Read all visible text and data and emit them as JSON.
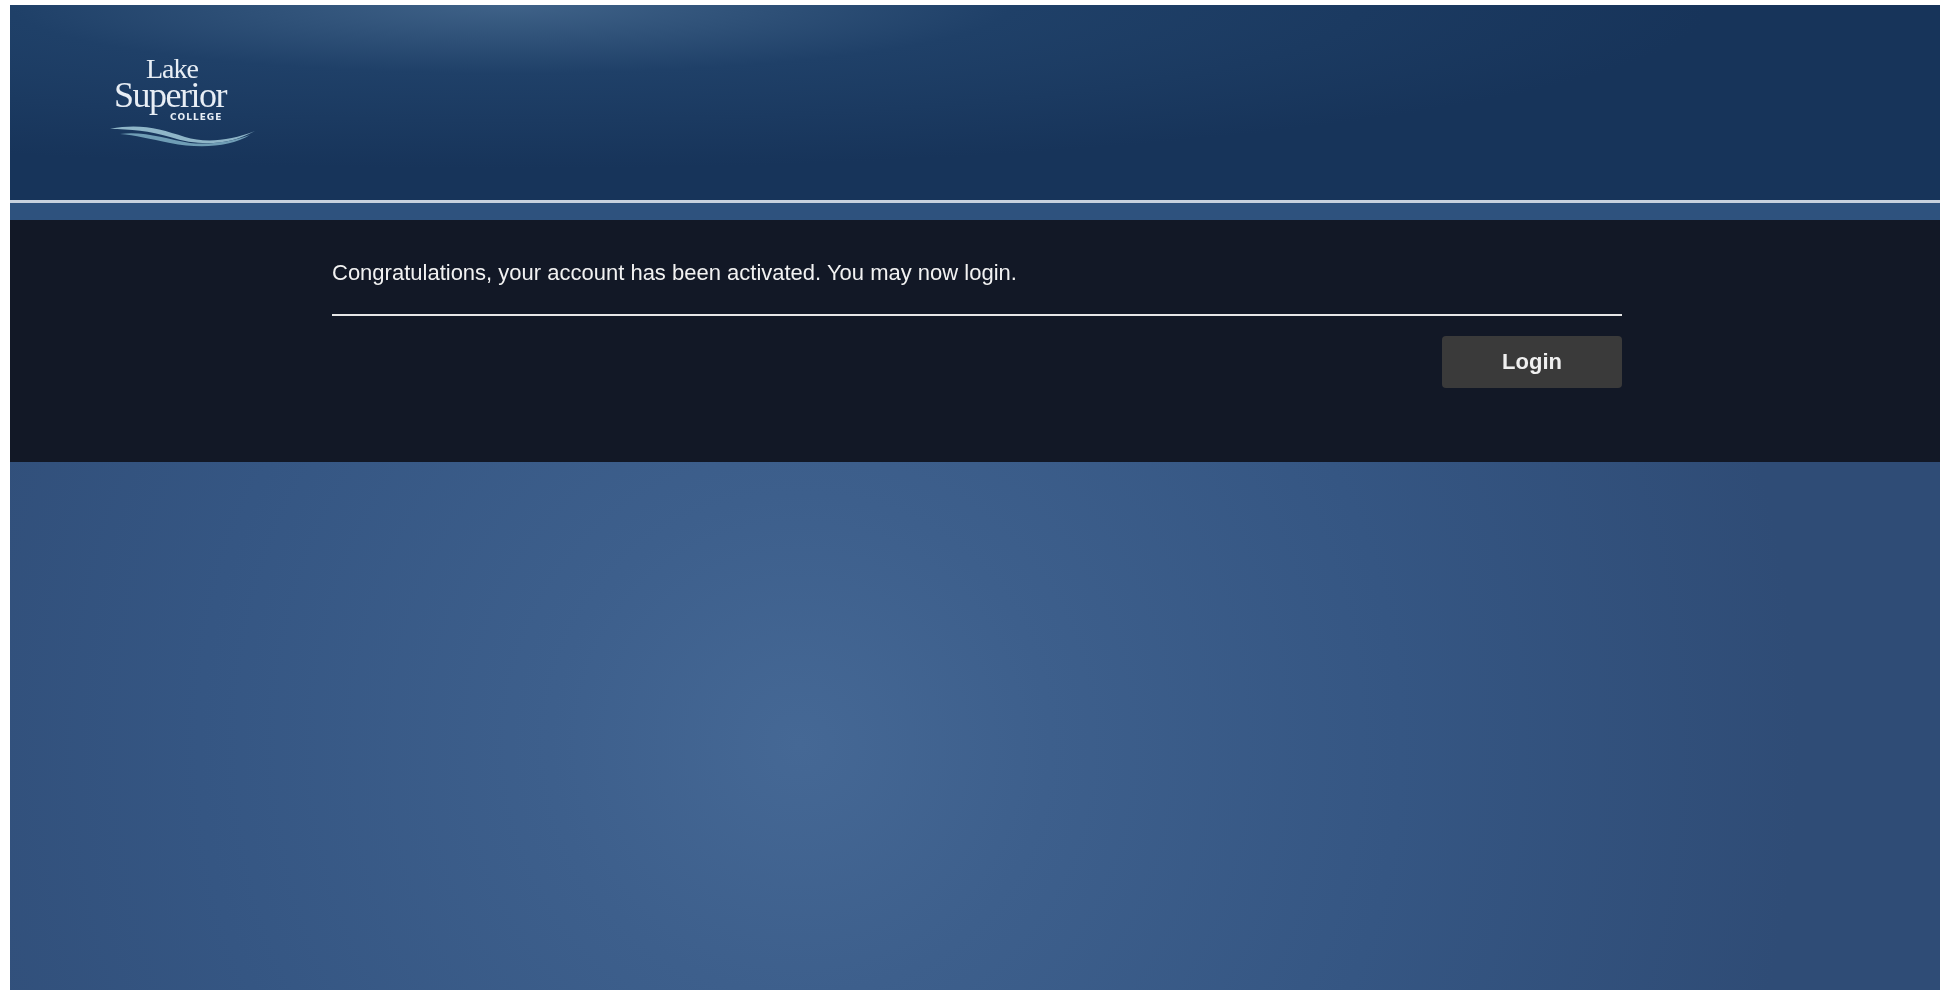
{
  "logo": {
    "line_1": "Lake",
    "line_2": "Superior",
    "line_3": "COLLEGE"
  },
  "message": {
    "text": "Congratulations, your account has been activated. You may now login."
  },
  "buttons": [
    {
      "label": "Login"
    }
  ]
}
